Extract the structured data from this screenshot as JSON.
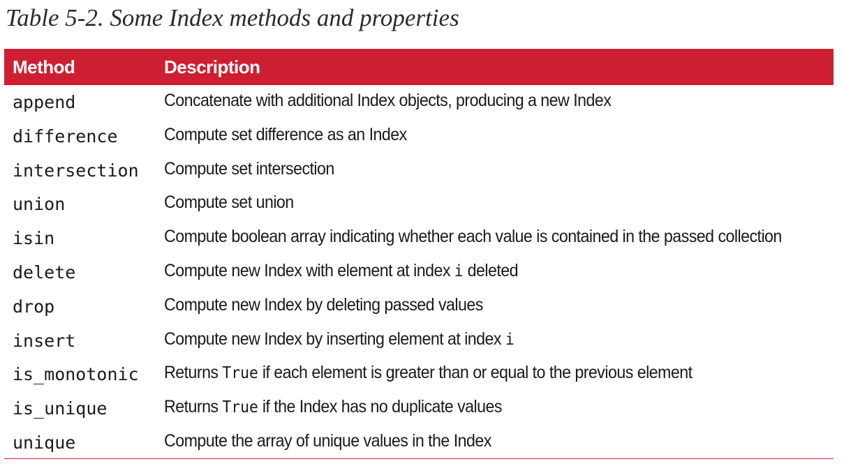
{
  "caption": "Table 5-2. Some Index methods and properties",
  "header": {
    "method": "Method",
    "description": "Description"
  },
  "rows": [
    {
      "method": "append",
      "desc": [
        {
          "t": "Concatenate with additional Index objects, producing a new Index"
        }
      ]
    },
    {
      "method": "difference",
      "desc": [
        {
          "t": "Compute set difference as an Index"
        }
      ]
    },
    {
      "method": "intersection",
      "desc": [
        {
          "t": "Compute set intersection"
        }
      ]
    },
    {
      "method": "union",
      "desc": [
        {
          "t": "Compute set union"
        }
      ]
    },
    {
      "method": "isin",
      "desc": [
        {
          "t": "Compute boolean array indicating whether each value is contained in the passed collection"
        }
      ]
    },
    {
      "method": "delete",
      "desc": [
        {
          "t": "Compute new Index with element at index "
        },
        {
          "t": "i",
          "code": true
        },
        {
          "t": " deleted"
        }
      ]
    },
    {
      "method": "drop",
      "desc": [
        {
          "t": "Compute new Index by deleting passed values"
        }
      ]
    },
    {
      "method": "insert",
      "desc": [
        {
          "t": "Compute new Index by inserting element at index "
        },
        {
          "t": "i",
          "code": true
        }
      ]
    },
    {
      "method": "is_monotonic",
      "desc": [
        {
          "t": "Returns "
        },
        {
          "t": "True",
          "code": true
        },
        {
          "t": " if each element is greater than or equal to the previous element"
        }
      ]
    },
    {
      "method": "is_unique",
      "desc": [
        {
          "t": "Returns "
        },
        {
          "t": "True",
          "code": true
        },
        {
          "t": " if the Index has no duplicate values"
        }
      ]
    },
    {
      "method": "unique",
      "desc": [
        {
          "t": "Compute the array of unique values in the Index"
        }
      ]
    }
  ],
  "colors": {
    "header_bg": "#cd1f31",
    "header_text": "#ffffff",
    "body_text": "#1a1a1a"
  }
}
